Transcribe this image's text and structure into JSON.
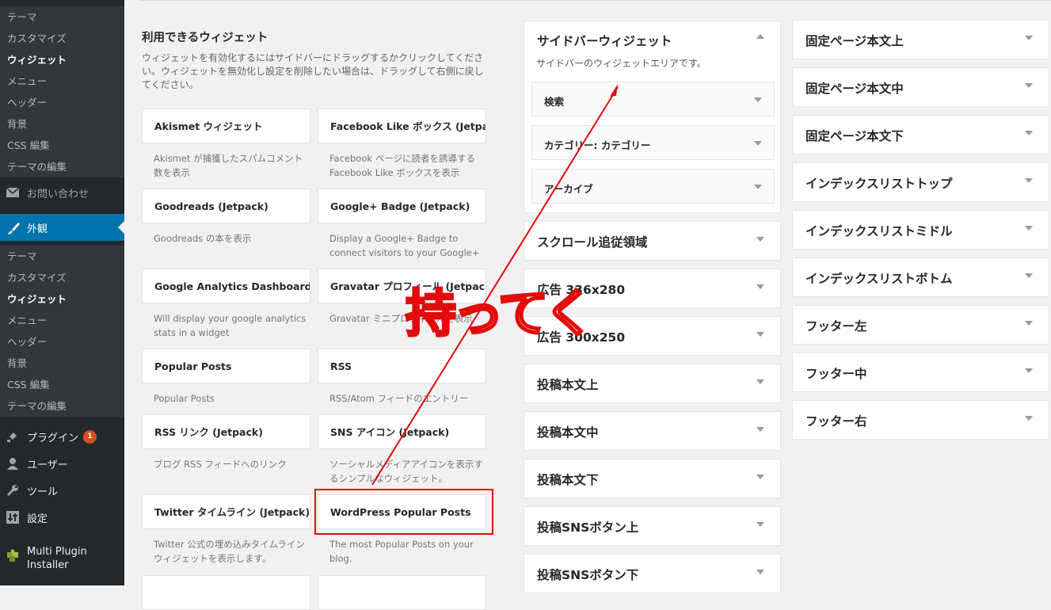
{
  "sidebar": {
    "submenu_top": [
      "テーマ",
      "カスタマイズ",
      "ウィジェット",
      "メニュー",
      "ヘッダー",
      "背景",
      "CSS 編集",
      "テーマの編集"
    ],
    "contact_label": "お問い合わせ",
    "appearance_label": "外観",
    "submenu_bottom": [
      "テーマ",
      "カスタマイズ",
      "ウィジェット",
      "メニュー",
      "ヘッダー",
      "背景",
      "CSS 編集",
      "テーマの編集"
    ],
    "plugins_label": "プラグイン",
    "plugins_badge": "1",
    "users_label": "ユーザー",
    "tools_label": "ツール",
    "settings_label": "設定",
    "mpi_label": "Multi Plugin Installer"
  },
  "available": {
    "title": "利用できるウィジェット",
    "description": "ウィジェットを有効化するにはサイドバーにドラッグするかクリックしてください。ウィジェットを無効化し設定を削除したい場合は、ドラッグして右側に戻してください。",
    "widgets": [
      {
        "title": "Akismet ウィジェット",
        "desc": "Akismet が捕獲したスパムコメント数を表示"
      },
      {
        "title": "Facebook Like ボックス (Jetpack)",
        "desc": "Facebook ページに読者を誘導する Facebook Like ボックスを表示"
      },
      {
        "title": "Goodreads (Jetpack)",
        "desc": "Goodreads の本を表示"
      },
      {
        "title": "Google+ Badge (Jetpack)",
        "desc": "Display a Google+ Badge to connect visitors to your Google+"
      },
      {
        "title": "Google Analytics Dashboard",
        "desc": "Will display your google analytics stats in a widget"
      },
      {
        "title": "Gravatar プロフィール (Jetpack)",
        "desc": "Gravatar ミニプロフィールを表示"
      },
      {
        "title": "Popular Posts",
        "desc": "Popular Posts"
      },
      {
        "title": "RSS",
        "desc": "RSS/Atom フィードのエントリー"
      },
      {
        "title": "RSS リンク (Jetpack)",
        "desc": "ブログ RSS フィードへのリンク"
      },
      {
        "title": "SNS アイコン (Jetpack)",
        "desc": "ソーシャルメディアアイコンを表示するシンプルなウィジェット。"
      },
      {
        "title": "Twitter タイムライン (Jetpack)",
        "desc": "Twitter 公式の埋め込みタイムラインウィジェットを表示します。"
      },
      {
        "title": "WordPress Popular Posts",
        "desc": "The most Popular Posts on your blog."
      }
    ]
  },
  "sidebar_widget": {
    "title": "サイドバーウィジェット",
    "description": "サイドバーのウィジェットエリアです。",
    "items": [
      "検索",
      "カテゴリー: カテゴリー",
      "アーカイブ"
    ]
  },
  "areas_col1": [
    "スクロール追従領域",
    "広告 336x280",
    "広告 300x250",
    "投稿本文上",
    "投稿本文中",
    "投稿本文下",
    "投稿SNSボタン上",
    "投稿SNSボタン下"
  ],
  "areas_col2": [
    "固定ページ本文上",
    "固定ページ本文中",
    "固定ページ本文下",
    "インデックスリストトップ",
    "インデックスリストミドル",
    "インデックスリストボトム",
    "フッター左",
    "フッター中",
    "フッター右"
  ],
  "annotation": "持ってく",
  "colors": {
    "accent": "#0073aa",
    "annotation": "#e20a0a",
    "sidebar": "#23282d"
  }
}
